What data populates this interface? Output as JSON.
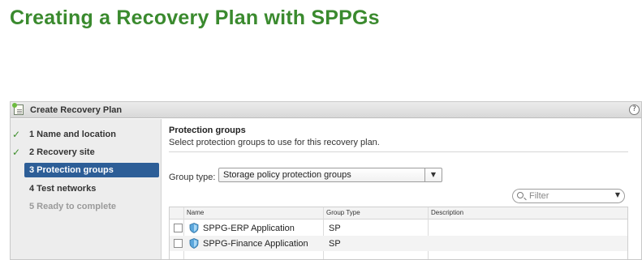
{
  "slide": {
    "title": "Creating a Recovery Plan with SPPGs"
  },
  "dialog": {
    "title": "Create Recovery Plan",
    "help": "?"
  },
  "wizard": {
    "steps": [
      {
        "label": "1  Name and location",
        "state": "completed",
        "check": "✓"
      },
      {
        "label": "2  Recovery site",
        "state": "completed",
        "check": "✓"
      },
      {
        "label": "3  Protection groups",
        "state": "active"
      },
      {
        "label": "4  Test networks",
        "state": "pending"
      },
      {
        "label": "5  Ready to complete",
        "state": "disabled"
      }
    ]
  },
  "content": {
    "section_title": "Protection groups",
    "section_subtitle": "Select protection groups to use for this recovery plan.",
    "group_type_label": "Group type:",
    "group_type_value": "Storage policy protection groups",
    "filter_placeholder": "Filter",
    "table": {
      "columns": [
        "Name",
        "Group Type",
        "Description"
      ],
      "rows": [
        {
          "name": "SPPG-ERP Application",
          "group_type": "SP",
          "description": "",
          "checked": false
        },
        {
          "name": "SPPG-Finance Application",
          "group_type": "SP",
          "description": "",
          "checked": false
        }
      ]
    }
  },
  "colors": {
    "title_green": "#3a8a2e",
    "active_step": "#2d5e97",
    "check_green": "#3e8f2c"
  },
  "icons": {
    "dialog": "recovery-plan-icon",
    "help": "help-icon",
    "search": "search-icon",
    "row": "shield-icon"
  }
}
